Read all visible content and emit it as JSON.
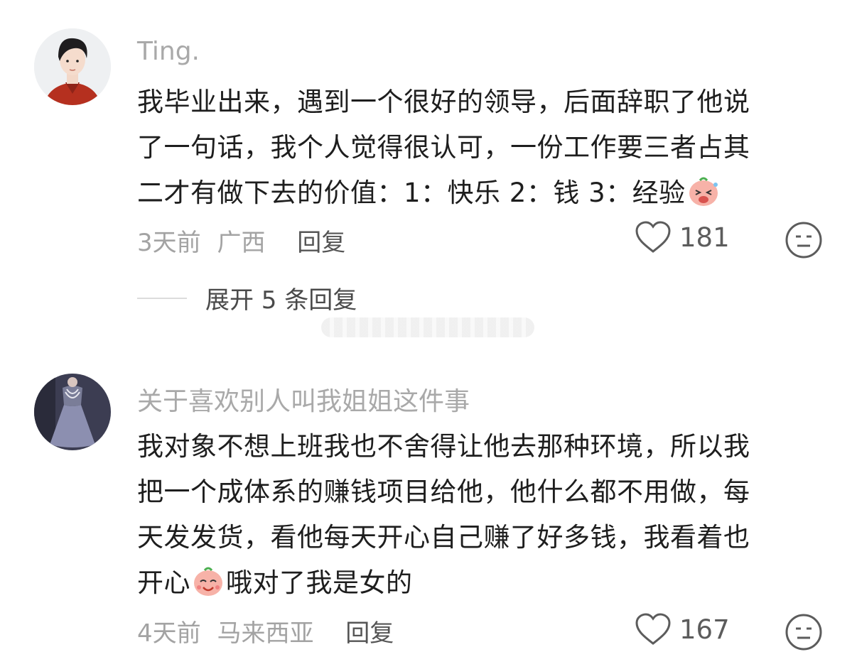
{
  "comments": [
    {
      "username": "Ting.",
      "lines": [
        "我毕业出来，遇到一个很好的领导，后面辞职了他说",
        "了一句话，我个人觉得很认可，一份工作要三者占其",
        "二才有做下去的价值：1：快乐 2：钱 3：经验"
      ],
      "time": "3天前",
      "location": "广西",
      "reply_label": "回复",
      "likes": "181",
      "avatar_icon": "avatar-man-red-shirt",
      "emoji_icon": "laughing-peach-emoji"
    },
    {
      "username": "关于喜欢别人叫我姐姐这件事",
      "lines": [
        "我对象不想上班我也不舍得让他去那种环境，所以我",
        "把一个成体系的赚钱项目给他，他什么都不用做，每",
        "天发发货，看他每天开心自己赚了好多钱，我看着也",
        "开心",
        "哦对了我是女的"
      ],
      "time": "4天前",
      "location": "马来西亚",
      "reply_label": "回复",
      "likes": "167",
      "avatar_icon": "avatar-woman-gray-dress",
      "emoji_icon": "smiling-peach-emoji"
    }
  ],
  "expand_replies": "展开 5 条回复",
  "colors": {
    "username": "#a9a9a9",
    "meta": "#a3a3a3",
    "text": "#1e1e1e",
    "icon": "#5c5c5c"
  }
}
